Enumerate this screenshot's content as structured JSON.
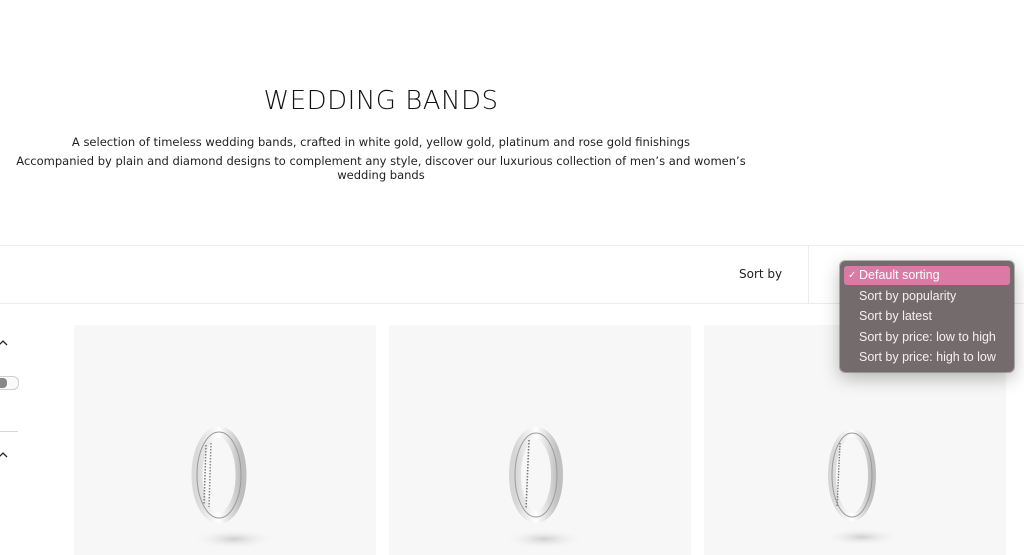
{
  "hero": {
    "title": "WEDDING BANDS",
    "description_line1": "A selection of timeless wedding bands, crafted in white gold, yellow gold, platinum and rose gold finishings",
    "description_line2": "Accompanied by plain and diamond designs to complement any style, discover our luxurious collection of men’s and women’s wedding bands"
  },
  "toolbar": {
    "sort_label": "Sort by"
  },
  "sort_menu": {
    "selected_marker": "✓",
    "options": [
      {
        "label": "Default sorting",
        "selected": true
      },
      {
        "label": "Sort by popularity",
        "selected": false
      },
      {
        "label": "Sort by latest",
        "selected": false
      },
      {
        "label": "Sort by price: low to high",
        "selected": false
      },
      {
        "label": "Sort by price: high to low",
        "selected": false
      }
    ]
  },
  "filters": {
    "chevron_icon": "chevron-up-icon",
    "toggle_icon": "toggle-switch-icon"
  },
  "products": [
    {
      "image_icon": "double-row-diamond-band-icon"
    },
    {
      "image_icon": "single-row-diamond-band-icon"
    },
    {
      "image_icon": "thin-diamond-band-icon"
    }
  ],
  "colors": {
    "menu_background": "#6e6666",
    "menu_highlight": "#dc7aa6",
    "card_background": "#f7f7f7"
  }
}
